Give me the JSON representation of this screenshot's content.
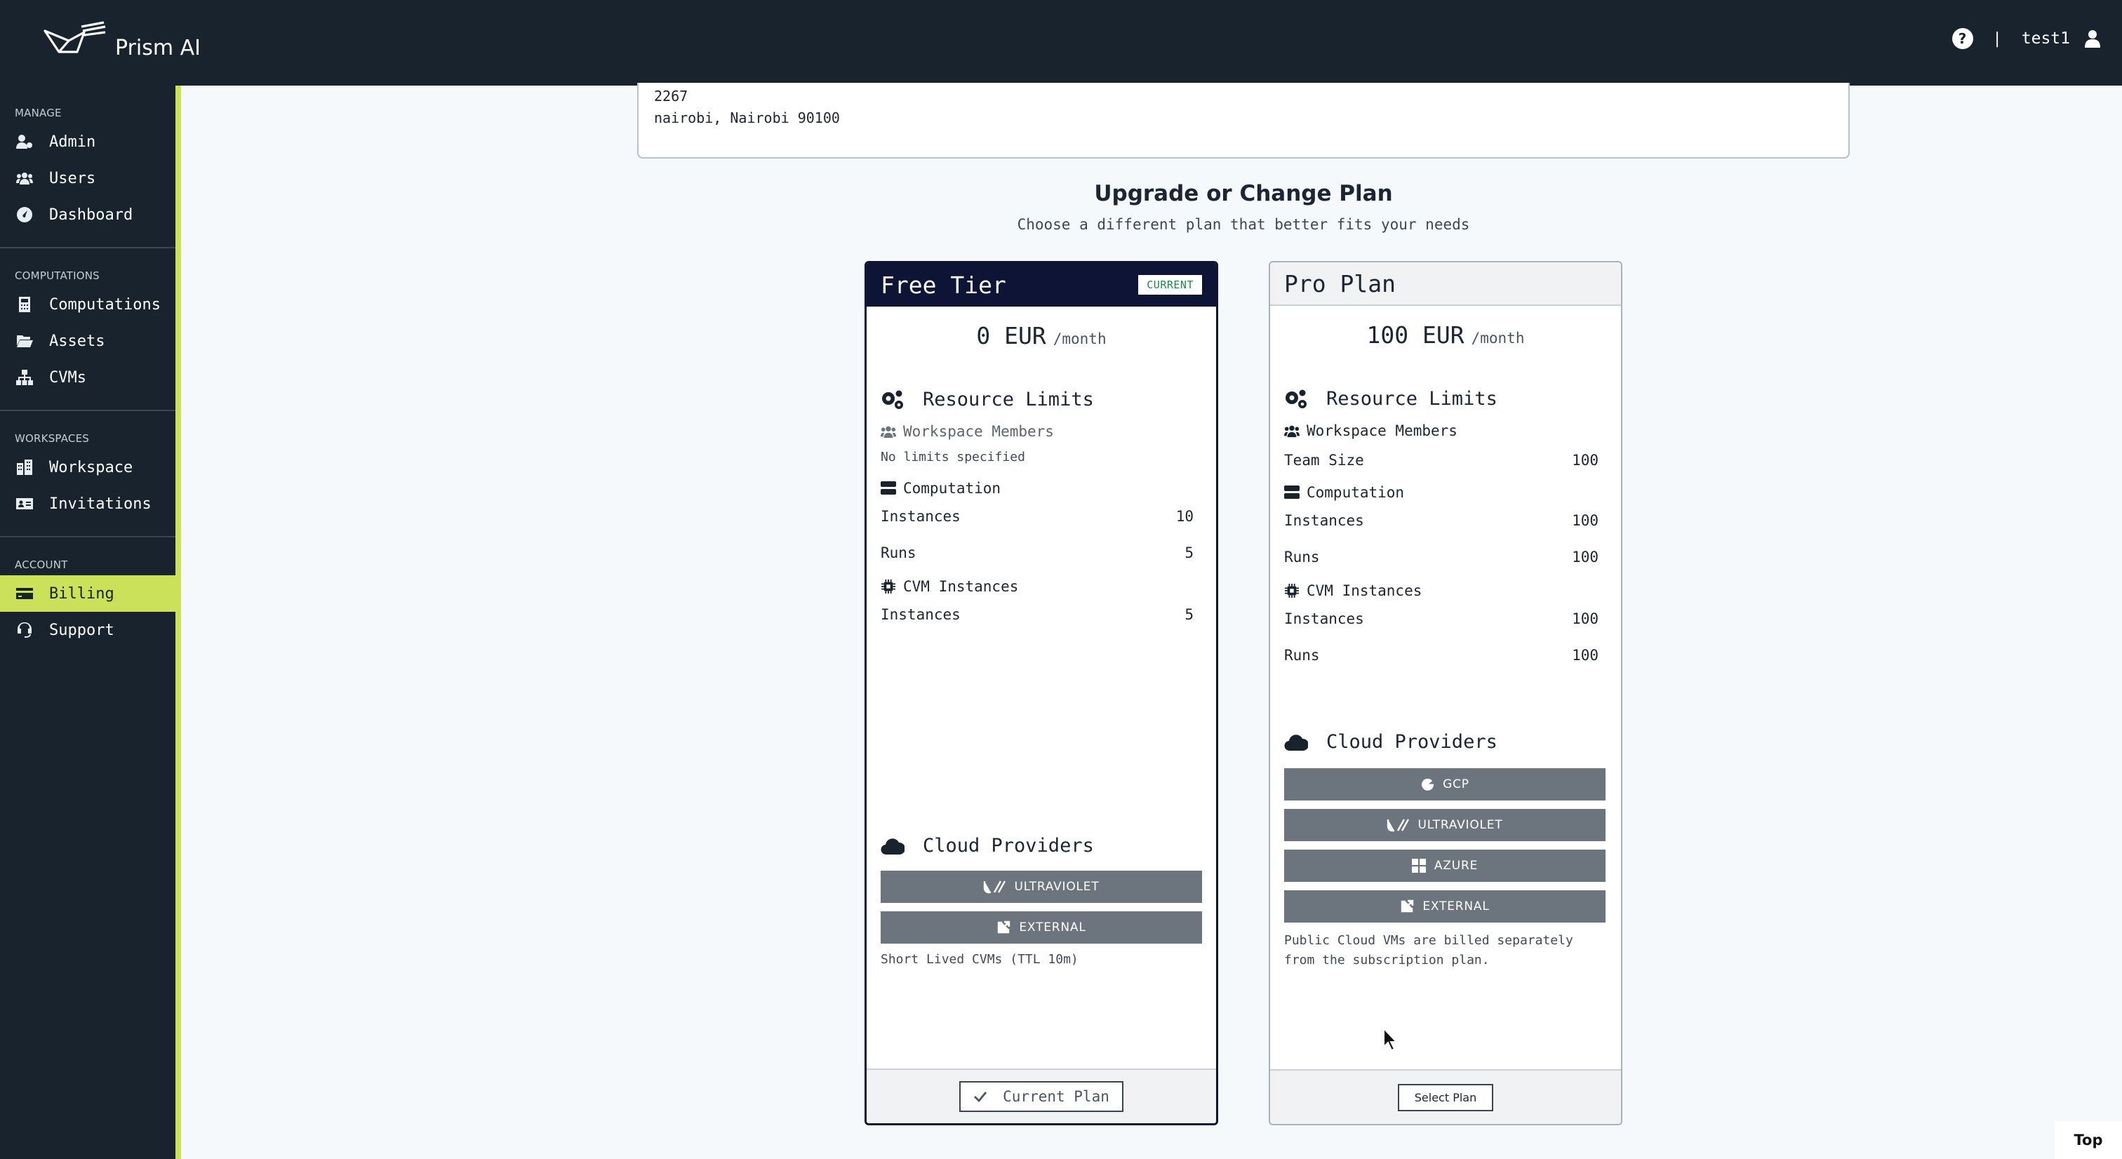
{
  "app": {
    "name": "Prism AI"
  },
  "header": {
    "separator": "|",
    "username": "test1",
    "help_icon": "?"
  },
  "sidebar": {
    "sections": [
      {
        "header": "MANAGE",
        "items": [
          {
            "label": "Admin",
            "icon": "user-gear-icon"
          },
          {
            "label": "Users",
            "icon": "users-icon"
          },
          {
            "label": "Dashboard",
            "icon": "gauge-icon"
          }
        ]
      },
      {
        "header": "COMPUTATIONS",
        "items": [
          {
            "label": "Computations",
            "icon": "calculator-icon"
          },
          {
            "label": "Assets",
            "icon": "folder-open-icon"
          },
          {
            "label": "CVMs",
            "icon": "sitemap-icon"
          }
        ]
      },
      {
        "header": "WORKSPACES",
        "items": [
          {
            "label": "Workspace",
            "icon": "building-icon"
          },
          {
            "label": "Invitations",
            "icon": "id-card-icon"
          }
        ]
      },
      {
        "header": "ACCOUNT",
        "items": [
          {
            "label": "Billing",
            "icon": "credit-card-icon",
            "active": true
          },
          {
            "label": "Support",
            "icon": "headset-icon"
          }
        ]
      }
    ]
  },
  "address": {
    "line1": "2267",
    "line2": "nairobi, Nairobi 90100"
  },
  "plans_section": {
    "title": "Upgrade or Change Plan",
    "subtitle": "Choose a different plan that better fits your needs"
  },
  "plans": {
    "free": {
      "name": "Free Tier",
      "badge": "CURRENT",
      "price": "0 EUR",
      "period": "/month",
      "resource_limits_title": "Resource Limits",
      "workspace_members_title": "Workspace Members",
      "workspace_members_note": "No limits specified",
      "computation_title": "Computation",
      "computation_rows": [
        {
          "label": "Instances",
          "value": "10"
        },
        {
          "label": "Runs",
          "value": "5"
        }
      ],
      "cvm_title": "CVM Instances",
      "cvm_rows": [
        {
          "label": "Instances",
          "value": "5"
        }
      ],
      "cloud_title": "Cloud Providers",
      "providers": [
        "ULTRAVIOLET",
        "EXTERNAL"
      ],
      "provider_note": "Short Lived CVMs (TTL 10m)",
      "action_label": "Current Plan"
    },
    "pro": {
      "name": "Pro Plan",
      "price": "100 EUR",
      "period": "/month",
      "resource_limits_title": "Resource Limits",
      "workspace_members_title": "Workspace Members",
      "team_row": {
        "label": "Team Size",
        "value": "100"
      },
      "computation_title": "Computation",
      "computation_rows": [
        {
          "label": "Instances",
          "value": "100"
        },
        {
          "label": "Runs",
          "value": "100"
        }
      ],
      "cvm_title": "CVM Instances",
      "cvm_rows": [
        {
          "label": "Instances",
          "value": "100"
        },
        {
          "label": "Runs",
          "value": "100"
        }
      ],
      "cloud_title": "Cloud Providers",
      "providers": [
        "GCP",
        "ULTRAVIOLET",
        "AZURE",
        "EXTERNAL"
      ],
      "provider_note": "Public Cloud VMs are billed separately from the subscription plan.",
      "action_label": "Select Plan"
    }
  },
  "top_link": "Top",
  "colors": {
    "sidebar_bg": "#18232d",
    "accent": "#cce15a",
    "current_plan_header": "#0d1436",
    "badge_text": "#1d8a4a"
  }
}
